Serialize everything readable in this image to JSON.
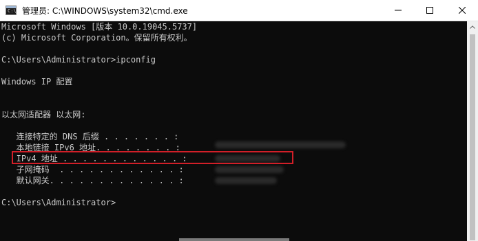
{
  "window": {
    "title": "管理员: C:\\WINDOWS\\system32\\cmd.exe",
    "icon_label": "C:\\"
  },
  "console": {
    "lines": [
      "Microsoft Windows [版本 10.0.19045.5737]",
      "(c) Microsoft Corporation。保留所有权利。",
      "",
      "C:\\Users\\Administrator>ipconfig",
      "",
      "Windows IP 配置",
      "",
      "",
      "以太网适配器 以太网:",
      "",
      "   连接特定的 DNS 后缀 . . . . . . . :",
      "   本地链接 IPv6 地址. . . . . . . . :",
      "   IPv4 地址 . . . . . . . . . . . . :",
      "   子网掩码  . . . . . . . . . . . . :",
      "   默认网关. . . . . . . . . . . . . :",
      "",
      "C:\\Users\\Administrator>"
    ]
  },
  "colors": {
    "console_bg": "#0c0c0c",
    "console_text": "#cccccc",
    "highlight": "#d21f28"
  },
  "icons": {
    "minimize": "minimize-icon",
    "maximize": "maximize-icon",
    "close": "close-icon",
    "scroll_up": "chevron-up-icon"
  }
}
